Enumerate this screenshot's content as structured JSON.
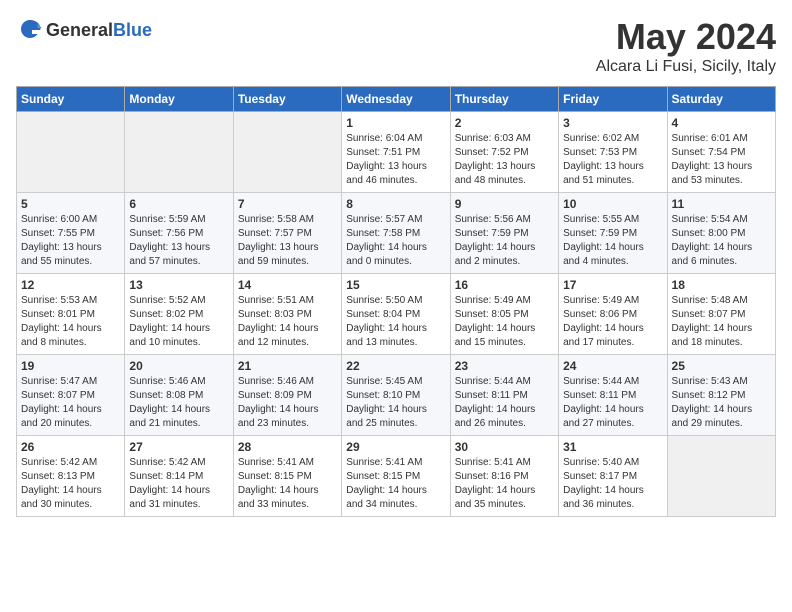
{
  "header": {
    "logo_general": "General",
    "logo_blue": "Blue",
    "month": "May 2024",
    "location": "Alcara Li Fusi, Sicily, Italy"
  },
  "days_of_week": [
    "Sunday",
    "Monday",
    "Tuesday",
    "Wednesday",
    "Thursday",
    "Friday",
    "Saturday"
  ],
  "weeks": [
    [
      {
        "day": "",
        "info": ""
      },
      {
        "day": "",
        "info": ""
      },
      {
        "day": "",
        "info": ""
      },
      {
        "day": "1",
        "info": "Sunrise: 6:04 AM\nSunset: 7:51 PM\nDaylight: 13 hours\nand 46 minutes."
      },
      {
        "day": "2",
        "info": "Sunrise: 6:03 AM\nSunset: 7:52 PM\nDaylight: 13 hours\nand 48 minutes."
      },
      {
        "day": "3",
        "info": "Sunrise: 6:02 AM\nSunset: 7:53 PM\nDaylight: 13 hours\nand 51 minutes."
      },
      {
        "day": "4",
        "info": "Sunrise: 6:01 AM\nSunset: 7:54 PM\nDaylight: 13 hours\nand 53 minutes."
      }
    ],
    [
      {
        "day": "5",
        "info": "Sunrise: 6:00 AM\nSunset: 7:55 PM\nDaylight: 13 hours\nand 55 minutes."
      },
      {
        "day": "6",
        "info": "Sunrise: 5:59 AM\nSunset: 7:56 PM\nDaylight: 13 hours\nand 57 minutes."
      },
      {
        "day": "7",
        "info": "Sunrise: 5:58 AM\nSunset: 7:57 PM\nDaylight: 13 hours\nand 59 minutes."
      },
      {
        "day": "8",
        "info": "Sunrise: 5:57 AM\nSunset: 7:58 PM\nDaylight: 14 hours\nand 0 minutes."
      },
      {
        "day": "9",
        "info": "Sunrise: 5:56 AM\nSunset: 7:59 PM\nDaylight: 14 hours\nand 2 minutes."
      },
      {
        "day": "10",
        "info": "Sunrise: 5:55 AM\nSunset: 7:59 PM\nDaylight: 14 hours\nand 4 minutes."
      },
      {
        "day": "11",
        "info": "Sunrise: 5:54 AM\nSunset: 8:00 PM\nDaylight: 14 hours\nand 6 minutes."
      }
    ],
    [
      {
        "day": "12",
        "info": "Sunrise: 5:53 AM\nSunset: 8:01 PM\nDaylight: 14 hours\nand 8 minutes."
      },
      {
        "day": "13",
        "info": "Sunrise: 5:52 AM\nSunset: 8:02 PM\nDaylight: 14 hours\nand 10 minutes."
      },
      {
        "day": "14",
        "info": "Sunrise: 5:51 AM\nSunset: 8:03 PM\nDaylight: 14 hours\nand 12 minutes."
      },
      {
        "day": "15",
        "info": "Sunrise: 5:50 AM\nSunset: 8:04 PM\nDaylight: 14 hours\nand 13 minutes."
      },
      {
        "day": "16",
        "info": "Sunrise: 5:49 AM\nSunset: 8:05 PM\nDaylight: 14 hours\nand 15 minutes."
      },
      {
        "day": "17",
        "info": "Sunrise: 5:49 AM\nSunset: 8:06 PM\nDaylight: 14 hours\nand 17 minutes."
      },
      {
        "day": "18",
        "info": "Sunrise: 5:48 AM\nSunset: 8:07 PM\nDaylight: 14 hours\nand 18 minutes."
      }
    ],
    [
      {
        "day": "19",
        "info": "Sunrise: 5:47 AM\nSunset: 8:07 PM\nDaylight: 14 hours\nand 20 minutes."
      },
      {
        "day": "20",
        "info": "Sunrise: 5:46 AM\nSunset: 8:08 PM\nDaylight: 14 hours\nand 21 minutes."
      },
      {
        "day": "21",
        "info": "Sunrise: 5:46 AM\nSunset: 8:09 PM\nDaylight: 14 hours\nand 23 minutes."
      },
      {
        "day": "22",
        "info": "Sunrise: 5:45 AM\nSunset: 8:10 PM\nDaylight: 14 hours\nand 25 minutes."
      },
      {
        "day": "23",
        "info": "Sunrise: 5:44 AM\nSunset: 8:11 PM\nDaylight: 14 hours\nand 26 minutes."
      },
      {
        "day": "24",
        "info": "Sunrise: 5:44 AM\nSunset: 8:11 PM\nDaylight: 14 hours\nand 27 minutes."
      },
      {
        "day": "25",
        "info": "Sunrise: 5:43 AM\nSunset: 8:12 PM\nDaylight: 14 hours\nand 29 minutes."
      }
    ],
    [
      {
        "day": "26",
        "info": "Sunrise: 5:42 AM\nSunset: 8:13 PM\nDaylight: 14 hours\nand 30 minutes."
      },
      {
        "day": "27",
        "info": "Sunrise: 5:42 AM\nSunset: 8:14 PM\nDaylight: 14 hours\nand 31 minutes."
      },
      {
        "day": "28",
        "info": "Sunrise: 5:41 AM\nSunset: 8:15 PM\nDaylight: 14 hours\nand 33 minutes."
      },
      {
        "day": "29",
        "info": "Sunrise: 5:41 AM\nSunset: 8:15 PM\nDaylight: 14 hours\nand 34 minutes."
      },
      {
        "day": "30",
        "info": "Sunrise: 5:41 AM\nSunset: 8:16 PM\nDaylight: 14 hours\nand 35 minutes."
      },
      {
        "day": "31",
        "info": "Sunrise: 5:40 AM\nSunset: 8:17 PM\nDaylight: 14 hours\nand 36 minutes."
      },
      {
        "day": "",
        "info": ""
      }
    ]
  ]
}
